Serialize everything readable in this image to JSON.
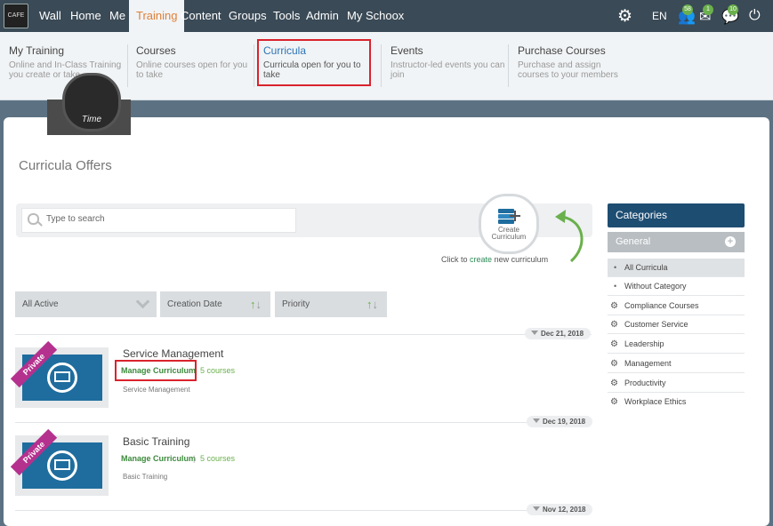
{
  "nav": {
    "logo_text": "CAFE",
    "items": [
      "Wall",
      "Home",
      "Me",
      "Training",
      "Content",
      "Groups",
      "Tools",
      "Admin",
      "My Schoox"
    ],
    "language": "EN",
    "badges": {
      "users": "58",
      "mail": "1",
      "chat": "10"
    },
    "icons": [
      "gears-icon",
      "users-icon",
      "mail-icon",
      "chat-icon",
      "power-icon"
    ]
  },
  "submenu": [
    {
      "title": "My Training",
      "desc": "Online and In-Class Training you create or take"
    },
    {
      "title": "Courses",
      "desc": "Online courses open for you to take"
    },
    {
      "title": "Curricula",
      "desc": "Curricula open for you to take"
    },
    {
      "title": "Events",
      "desc": "Instructor-led events you can join"
    },
    {
      "title": "Purchase Courses",
      "desc": "Purchase and assign courses to your members"
    }
  ],
  "avatar_text": "Time",
  "page_title": "Curricula Offers",
  "search": {
    "placeholder": "Type to search"
  },
  "create": {
    "label": "Create Curriculum",
    "hint_prefix": "Click to",
    "hint_link": "create",
    "hint_suffix": "new curriculum"
  },
  "filters": {
    "status": "All Active",
    "sort1": "Creation Date",
    "sort2": "Priority"
  },
  "curricula": [
    {
      "date": "Dec 21, 2018",
      "title": "Service Management",
      "manage": "Manage Curriculum",
      "count": "5 courses",
      "category": "Service Management",
      "badge": "Private"
    },
    {
      "date": "Dec 19, 2018",
      "title": "Basic Training",
      "manage": "Manage Curriculum",
      "count": "5 courses",
      "category": "Basic Training",
      "badge": "Private"
    },
    {
      "date": "Nov 12, 2018"
    }
  ],
  "categories": {
    "heading": "Categories",
    "general": "General",
    "items": [
      "All Curricula",
      "Without Category",
      "Compliance Courses",
      "Customer Service",
      "Leadership",
      "Management",
      "Productivity",
      "Workplace Ethics"
    ]
  },
  "colors": {
    "nav_bg": "#3a4a56",
    "accent_orange": "#e0803a",
    "link_blue": "#2d74b5",
    "green": "#6ab04c",
    "category_header": "#1e4d72",
    "ribbon": "#b5318e",
    "highlight_box": "#d9232d"
  }
}
